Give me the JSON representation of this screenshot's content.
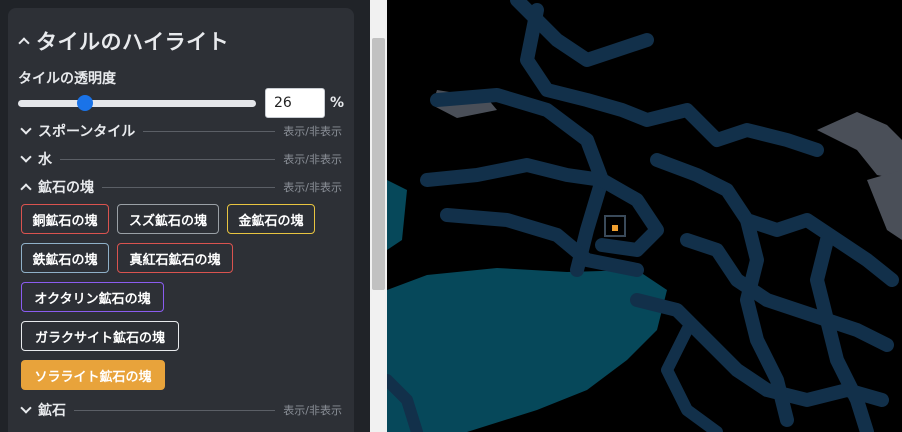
{
  "panel": {
    "title": "タイルのハイライト",
    "opacity_label": "タイルの透明度",
    "opacity_value": "26",
    "opacity_fraction": 0.28,
    "percent_sign": "%"
  },
  "sections": [
    {
      "label": "スポーンタイル",
      "toggle": "表示/非表示"
    },
    {
      "label": "水",
      "toggle": "表示/非表示"
    },
    {
      "label": "鉱石の塊",
      "toggle": "表示/非表示"
    },
    {
      "label": "鉱石",
      "toggle": "表示/非表示"
    }
  ],
  "ore_buttons": [
    {
      "label": "銅鉱石の塊",
      "border_color": "#d9534f",
      "active": false
    },
    {
      "label": "スズ鉱石の塊",
      "border_color": "#9aa0a6",
      "active": false
    },
    {
      "label": "金鉱石の塊",
      "border_color": "#e8c440",
      "active": false
    },
    {
      "label": "鉄鉱石の塊",
      "border_color": "#8fb0c8",
      "active": false
    },
    {
      "label": "真紅石鉱石の塊",
      "border_color": "#d9534f",
      "active": false
    },
    {
      "label": "オクタリン鉱石の塊",
      "border_color": "#8a5cf0",
      "active": false
    },
    {
      "label": "ガラクサイト鉱石の塊",
      "border_color": "#e8eaed",
      "active": false
    },
    {
      "label": "ソラライト鉱石の塊",
      "border_color": "#e8a33b",
      "active": true
    }
  ],
  "colors": {
    "accent": "#1a73e8",
    "active_button": "#e8a33b",
    "map_background": "#000000",
    "cave_floor": "#12304a",
    "water": "#06485a",
    "stone": "#4a4f58",
    "marker": "#f0a030"
  }
}
